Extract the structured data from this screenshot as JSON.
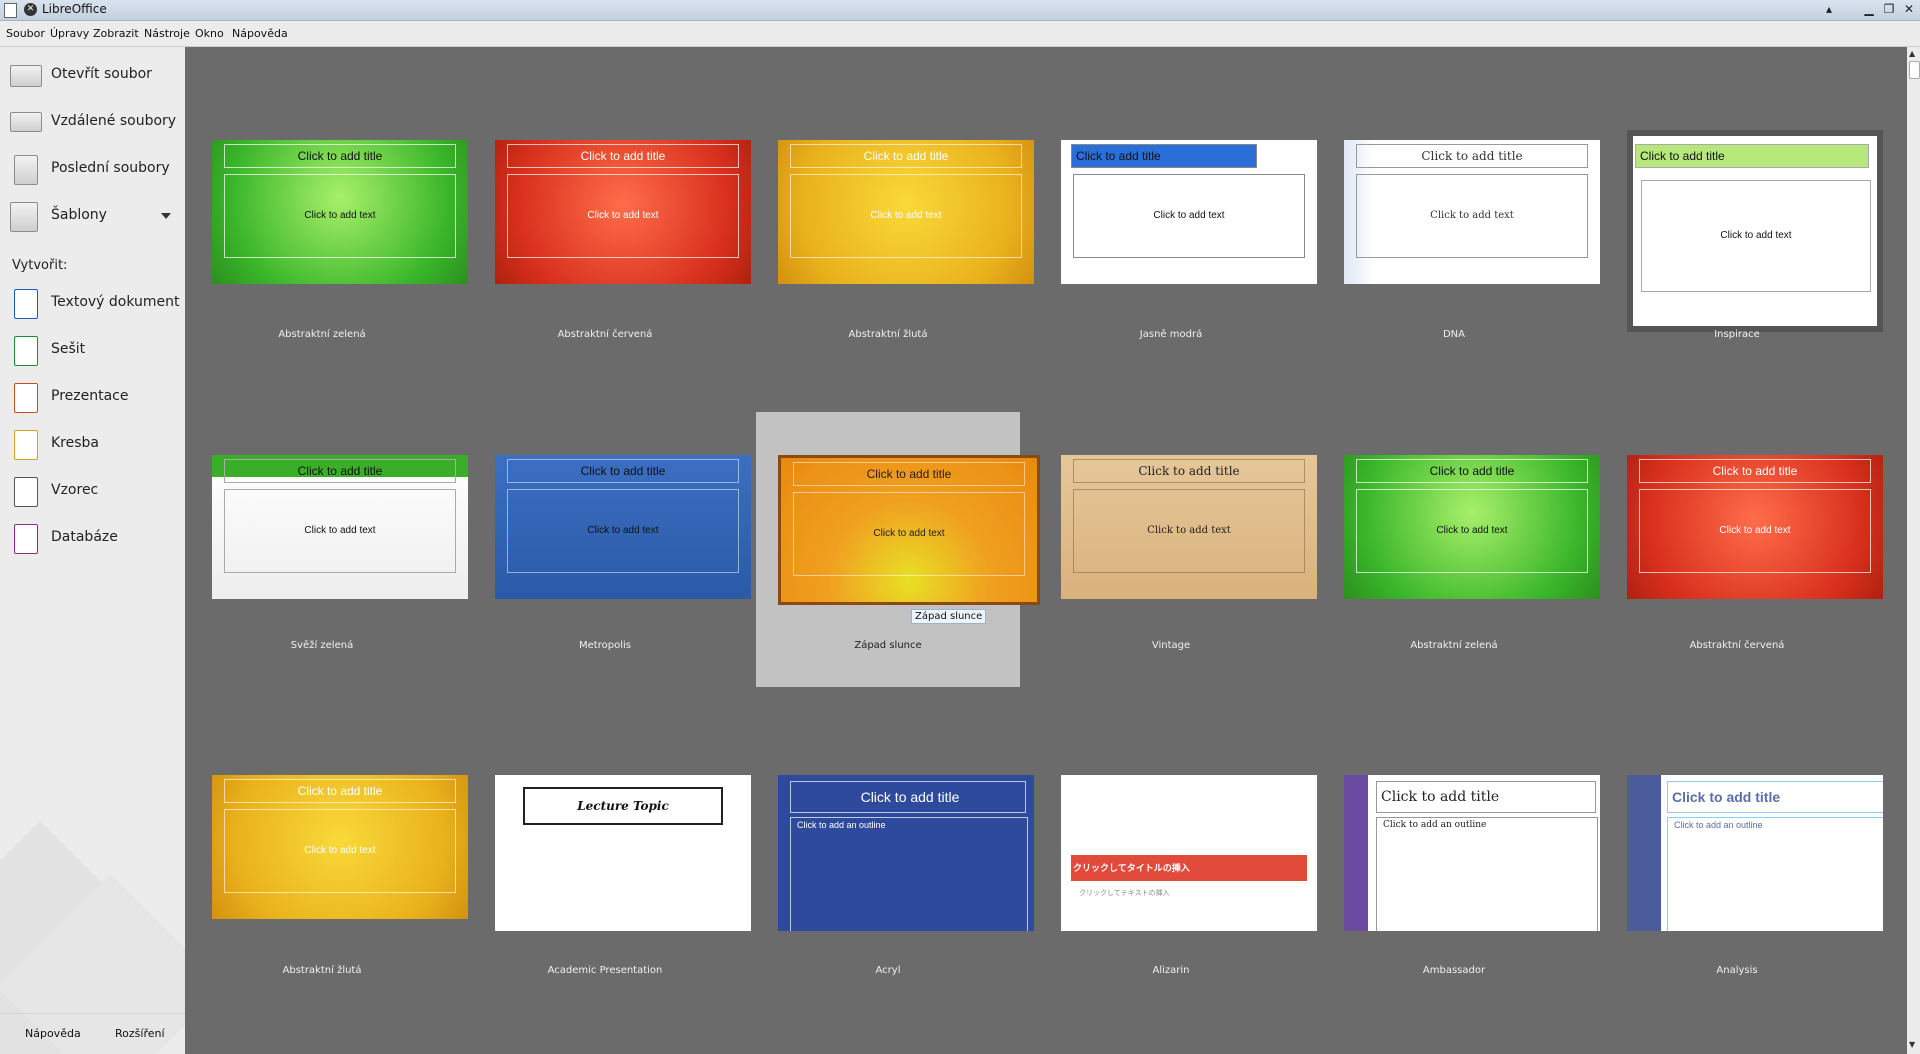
{
  "window": {
    "title": "LibreOffice"
  },
  "menu": [
    "Soubor",
    "Úpravy",
    "Zobrazit",
    "Nástroje",
    "Okno",
    "Nápověda"
  ],
  "sidebar": {
    "items": [
      {
        "label": "Otevřít soubor",
        "icon": "folder-open-icon"
      },
      {
        "label": "Vzdálené soubory",
        "icon": "remote-files-icon"
      },
      {
        "label": "Poslední soubory",
        "icon": "recent-files-icon"
      },
      {
        "label": "Šablony",
        "icon": "templates-icon"
      }
    ],
    "create_label": "Vytvořit:",
    "create": [
      {
        "label": "Textový dokument",
        "icon": "writer-icon",
        "color": "#1e5bb8"
      },
      {
        "label": "Sešit",
        "icon": "calc-icon",
        "color": "#1f8a3a"
      },
      {
        "label": "Prezentace",
        "icon": "impress-icon",
        "color": "#c4501d"
      },
      {
        "label": "Kresba",
        "icon": "draw-icon",
        "color": "#d4a417"
      },
      {
        "label": "Vzorec",
        "icon": "math-icon",
        "color": "#555555"
      },
      {
        "label": "Databáze",
        "icon": "base-icon",
        "color": "#8a2d8a"
      }
    ],
    "footer": {
      "help": "Nápověda",
      "extensions": "Rozšíření"
    }
  },
  "templates": [
    {
      "name": "Abstraktní zelená",
      "style": "green",
      "title": "Click to add title",
      "text": "Click to add text"
    },
    {
      "name": "Abstraktní červená",
      "style": "red",
      "title": "Click to add title",
      "text": "Click to add text"
    },
    {
      "name": "Abstraktní žlutá",
      "style": "yellow",
      "title": "Click to add title",
      "text": "Click to add text"
    },
    {
      "name": "Jasně modrá",
      "style": "brightblue",
      "title": "Click to add title",
      "text": "Click to add text"
    },
    {
      "name": "DNA",
      "style": "dna",
      "title": "Click to add title",
      "text": "Click to add text"
    },
    {
      "name": "Inspirace",
      "style": "inspiration",
      "title": "Click to add title",
      "text": "Click to add text"
    },
    {
      "name": "Svěží zelená",
      "style": "freshgreen",
      "title": "Click to add title",
      "text": "Click to add text"
    },
    {
      "name": "Metropolis",
      "style": "metropolis",
      "title": "Click to add title",
      "text": "Click to add text"
    },
    {
      "name": "Západ slunce",
      "style": "sunset",
      "title": "Click to add title",
      "text": "Click to add text",
      "selected": true,
      "tooltip": "Západ slunce"
    },
    {
      "name": "Vintage",
      "style": "vintage",
      "title": "Click to add title",
      "text": "Click to add text"
    },
    {
      "name": "Abstraktní zelená",
      "style": "green",
      "title": "Click to add title",
      "text": "Click to add text"
    },
    {
      "name": "Abstraktní červená",
      "style": "red",
      "title": "Click to add title",
      "text": "Click to add text"
    },
    {
      "name": "Abstraktní žlutá",
      "style": "yellow",
      "title": "Click to add title",
      "text": "Click to add text"
    },
    {
      "name": "Academic Presentation",
      "style": "academic",
      "title": "Lecture Topic",
      "text": ""
    },
    {
      "name": "Acryl",
      "style": "acryl",
      "title": "Click to add title",
      "text": "Click to add an outline"
    },
    {
      "name": "Alizarin",
      "style": "alizarin",
      "title": "クリックしてタイトルの挿入",
      "text": "クリックしてテキストの挿入"
    },
    {
      "name": "Ambassador",
      "style": "ambassador",
      "title": "Click to add title",
      "text": "Click to add an outline"
    },
    {
      "name": "Analysis",
      "style": "analysis",
      "title": "Click to add title",
      "text": "Click to add an outline"
    }
  ]
}
